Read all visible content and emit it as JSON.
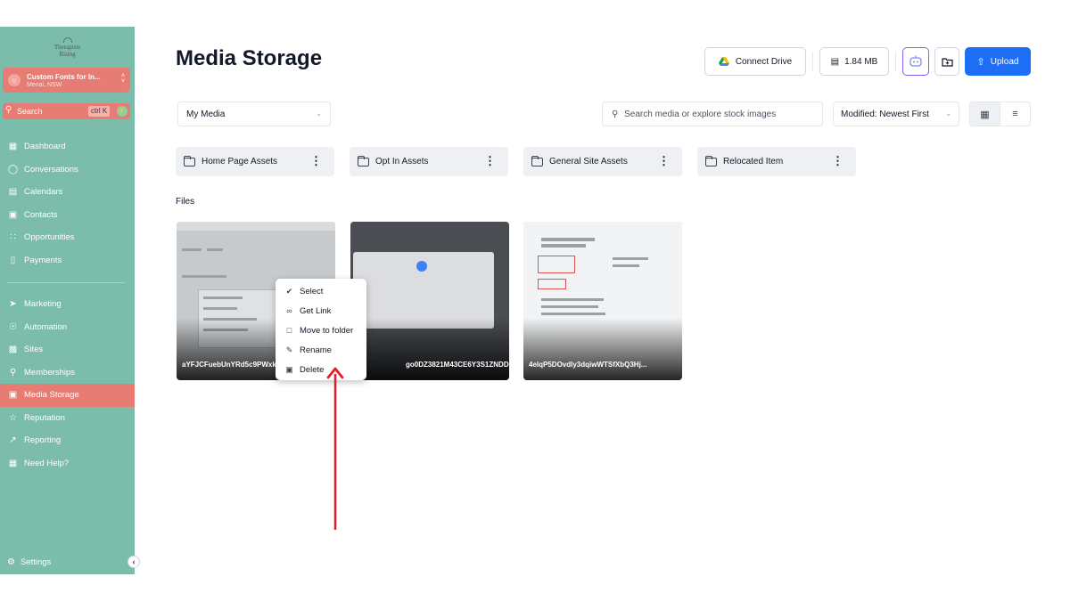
{
  "sidebar": {
    "logo_line1": "Therapists",
    "logo_line2": "Rising",
    "account": {
      "name": "Custom Fonts for In...",
      "location": "Menai, NSW"
    },
    "search": {
      "label": "Search",
      "shortcut": "ctrl K"
    },
    "items": [
      {
        "label": "Dashboard",
        "icon": "dashboard-icon"
      },
      {
        "label": "Conversations",
        "icon": "chat-icon"
      },
      {
        "label": "Calendars",
        "icon": "calendar-icon"
      },
      {
        "label": "Contacts",
        "icon": "contacts-icon"
      },
      {
        "label": "Opportunities",
        "icon": "opportunities-icon"
      },
      {
        "label": "Payments",
        "icon": "payments-icon"
      }
    ],
    "items2": [
      {
        "label": "Marketing",
        "icon": "send-icon"
      },
      {
        "label": "Automation",
        "icon": "automation-icon"
      },
      {
        "label": "Sites",
        "icon": "sites-icon"
      },
      {
        "label": "Memberships",
        "icon": "membership-icon"
      },
      {
        "label": "Media Storage",
        "icon": "image-icon",
        "active": true
      },
      {
        "label": "Reputation",
        "icon": "star-icon"
      },
      {
        "label": "Reporting",
        "icon": "trend-icon"
      },
      {
        "label": "Need Help?",
        "icon": "book-icon"
      }
    ],
    "settings_label": "Settings"
  },
  "header": {
    "title": "Media Storage",
    "connect_drive": "Connect Drive",
    "storage_used": "1.84 MB",
    "upload": "Upload"
  },
  "toolbar": {
    "folder_select": "My Media",
    "search_placeholder": "Search media or explore stock images",
    "sort": "Modified: Newest First"
  },
  "folders": [
    {
      "name": "Home Page Assets"
    },
    {
      "name": "Opt In Assets"
    },
    {
      "name": "General Site Assets"
    },
    {
      "name": "Relocated Item"
    }
  ],
  "files_label": "Files",
  "files": [
    {
      "name": "aYFJCFuebUnYRd5c9PWxk"
    },
    {
      "name": "go0DZ3821M43CE6Y3S1ZNDD..."
    },
    {
      "name": "4elqP5DOvdly3dqiwWTSfXbQ3Hj..."
    }
  ],
  "context_menu": [
    {
      "label": "Select",
      "icon": "check-circle-icon"
    },
    {
      "label": "Get Link",
      "icon": "link-icon"
    },
    {
      "label": "Move to folder",
      "icon": "folder-icon"
    },
    {
      "label": "Rename",
      "icon": "rename-icon"
    },
    {
      "label": "Delete",
      "icon": "trash-icon"
    }
  ],
  "colors": {
    "sidebar": "#7bbcab",
    "accent": "#e77c74",
    "primary_button": "#1d6ef5",
    "arrow": "#e11d2a"
  }
}
